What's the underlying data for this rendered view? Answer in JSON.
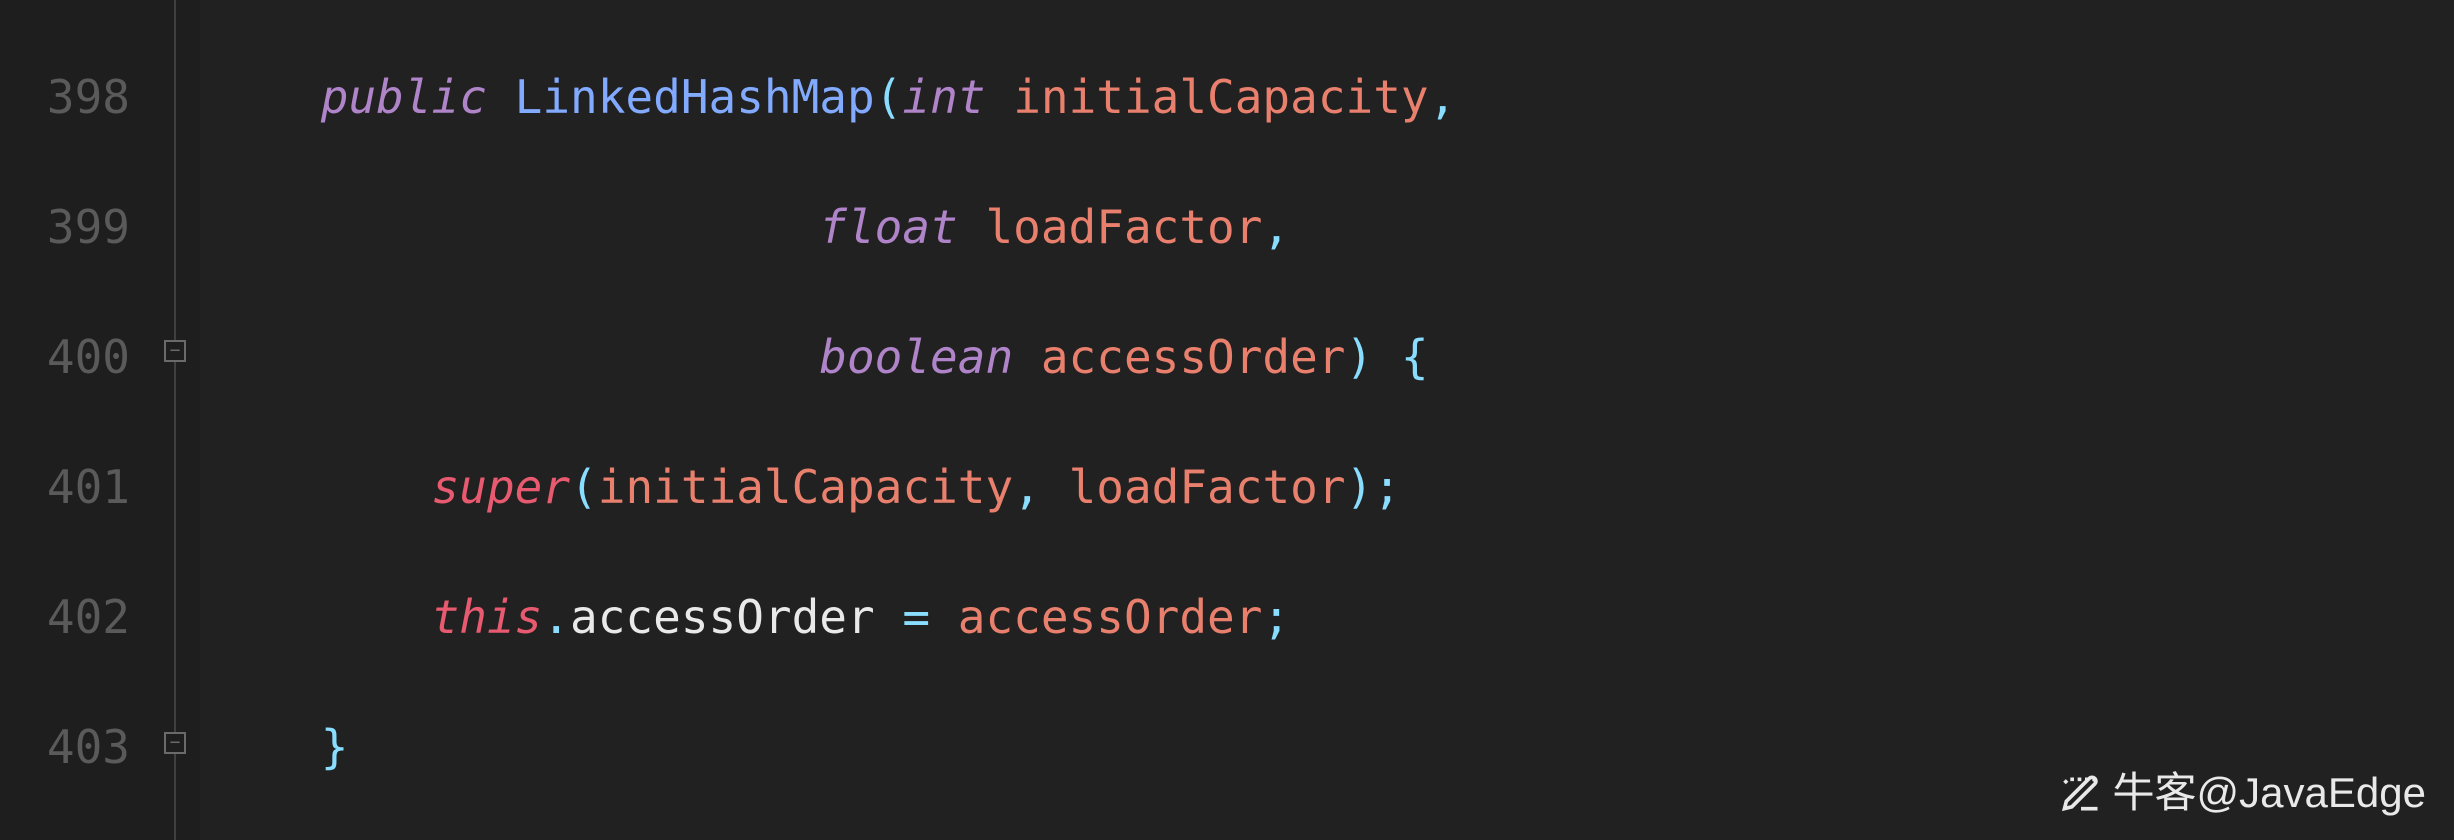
{
  "gutter": {
    "lines": [
      "398",
      "399",
      "400",
      "401",
      "402",
      "403"
    ]
  },
  "code": {
    "l398": {
      "indent": "    ",
      "kw_public": "public",
      "sp1": " ",
      "class_name": "LinkedHashMap",
      "paren_open": "(",
      "type_int": "int",
      "sp2": " ",
      "param_initialCapacity": "initialCapacity",
      "comma": ","
    },
    "l399": {
      "indent": "                      ",
      "type_float": "float",
      "sp": " ",
      "param_loadFactor": "loadFactor",
      "comma": ","
    },
    "l400": {
      "indent": "                      ",
      "type_boolean": "boolean",
      "sp": " ",
      "param_accessOrder": "accessOrder",
      "paren_close": ")",
      "sp2": " ",
      "brace_open": "{"
    },
    "l401": {
      "indent": "        ",
      "kw_super": "super",
      "paren_open": "(",
      "param_initialCapacity": "initialCapacity",
      "comma": ",",
      "sp": " ",
      "param_loadFactor": "loadFactor",
      "paren_close": ")",
      "semi": ";"
    },
    "l402": {
      "indent": "        ",
      "kw_this": "this",
      "dot": ".",
      "member_accessOrder": "accessOrder",
      "sp1": " ",
      "op_eq": "=",
      "sp2": " ",
      "param_accessOrder": "accessOrder",
      "semi": ";"
    },
    "l403": {
      "indent": "    ",
      "brace_close": "}"
    }
  },
  "watermark": {
    "text": "牛客@JavaEdge"
  }
}
